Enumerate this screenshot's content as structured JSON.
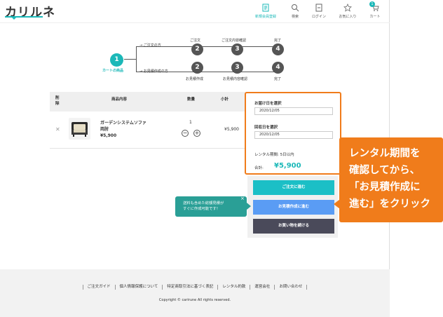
{
  "header": {
    "logo": "カリルネ",
    "nav": [
      {
        "label": "新規会員登録",
        "icon": "register-icon"
      },
      {
        "label": "検索",
        "icon": "search-icon"
      },
      {
        "label": "ログイン",
        "icon": "login-icon"
      },
      {
        "label": "お気に入り",
        "icon": "star-icon"
      },
      {
        "label": "カート",
        "icon": "cart-icon"
      }
    ],
    "cart_count": "1"
  },
  "flow": {
    "start_num": "1",
    "start_label": "カートの商品",
    "order_branch": "ご注文の方",
    "estimate_branch": "お見積作成の方",
    "top_steps": [
      {
        "num": "2",
        "label": "ご注文"
      },
      {
        "num": "3",
        "label": "ご注文内容確認"
      },
      {
        "num": "4",
        "label": "完了"
      }
    ],
    "bottom_steps": [
      {
        "num": "2",
        "label": "お見積作成"
      },
      {
        "num": "3",
        "label": "お見積内容確認"
      },
      {
        "num": "4",
        "label": "完了"
      }
    ]
  },
  "cart_table": {
    "headers": {
      "delete": "削\n除",
      "product": "商品内容",
      "quantity": "数量",
      "subtotal": "小計"
    },
    "item": {
      "name_line1": "ガーデンシステムソファ",
      "name_line2": "両肘",
      "price": "¥5,900",
      "quantity": "1",
      "subtotal": "¥5,900"
    }
  },
  "panel": {
    "delivery_label": "お届け日を選択",
    "delivery_date": "2020/12/05",
    "pickup_label": "回収日を選択",
    "pickup_date": "2020/12/05",
    "period_text": "レンタル期間: 5日以内",
    "total_label": "合計:",
    "total_value": "¥5,900"
  },
  "buttons": {
    "order": "ご注文に進む",
    "estimate": "お見積作成に進む",
    "continue": "お買い物を続ける"
  },
  "tooltip": {
    "line1": "送料も含めた総額見積が",
    "line2": "すぐに作成可能です！",
    "close": "×"
  },
  "callout": {
    "line1": "レンタル期間を",
    "line2": "確認してから、",
    "line3": "「お見積作成に",
    "line4": "進む」をクリック"
  },
  "footer": {
    "links": [
      "ご注文ガイド",
      "個人情報保護について",
      "特定商取引法に基づく表記",
      "レンタル約款",
      "運営会社",
      "お問い合わせ"
    ],
    "copyright": "Copyright © carirune All rights reserved."
  },
  "colors": {
    "accent": "#1bb8b8",
    "callout": "#f07c1b",
    "estimate_button": "#5a9cf4"
  }
}
